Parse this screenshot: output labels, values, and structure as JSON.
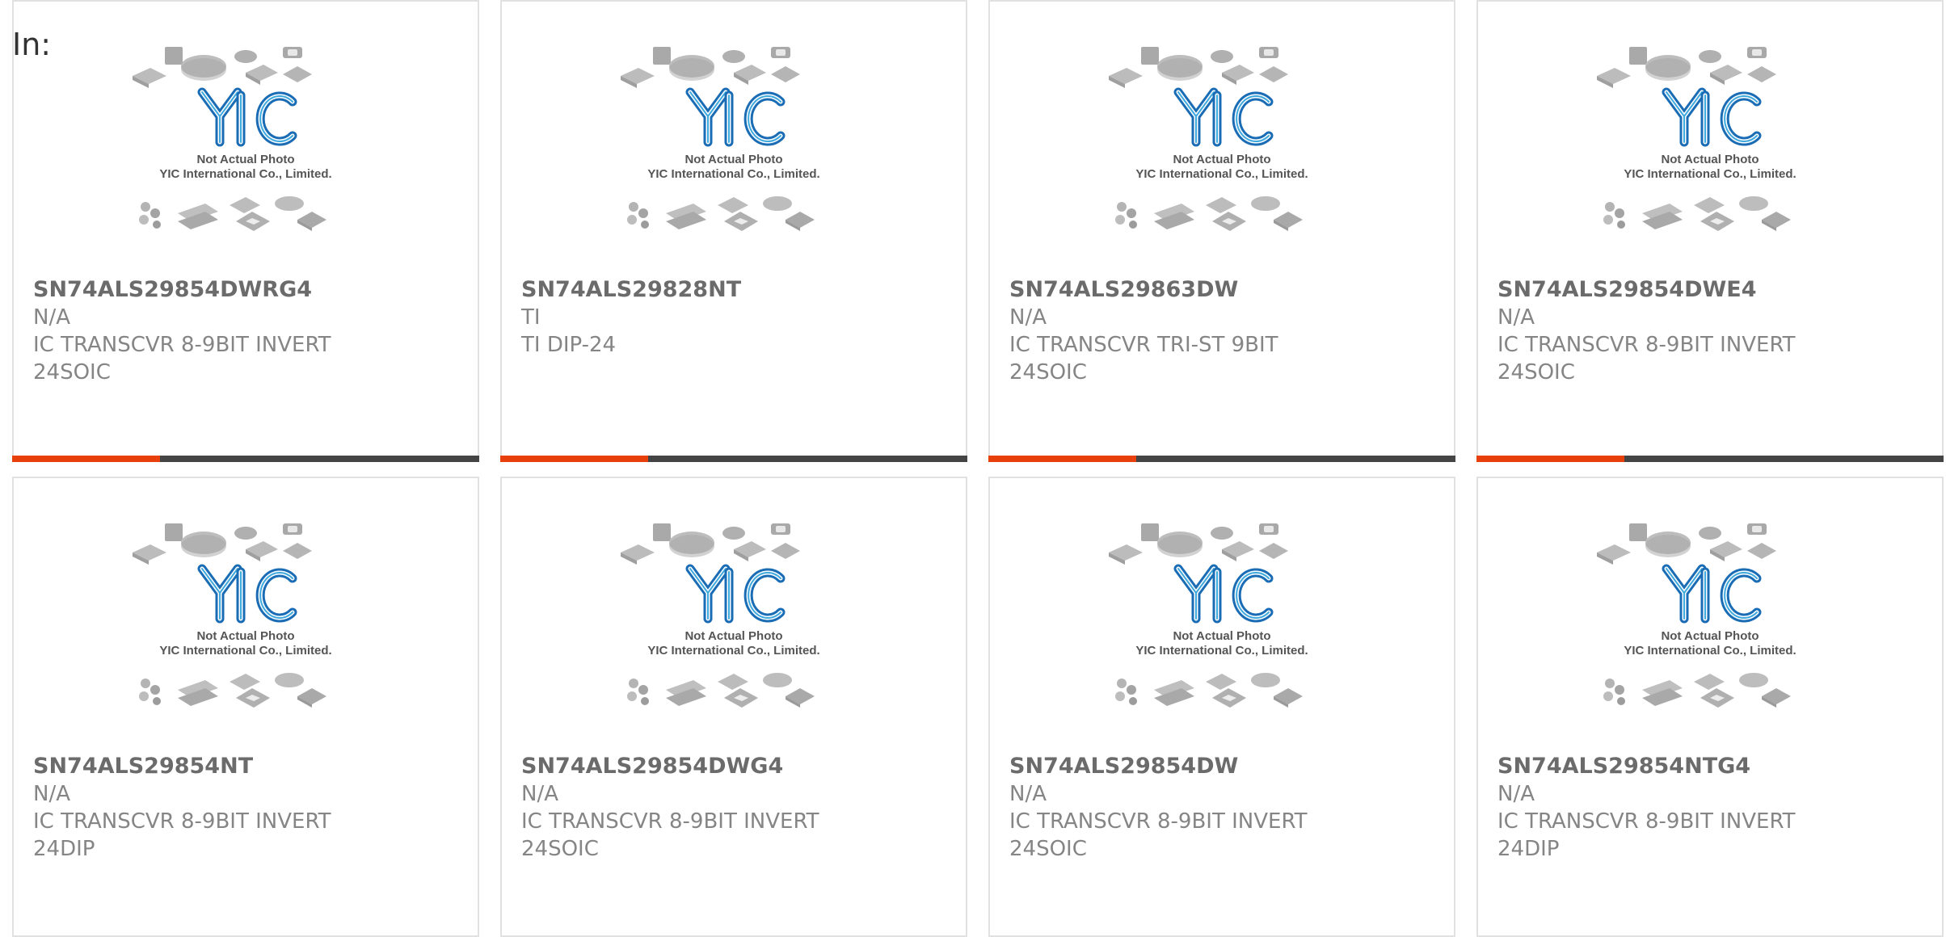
{
  "heading": "In:",
  "accent_color": "#e8400c",
  "bar_color": "#444444",
  "placeholder_image": {
    "icon": "chip-packages-placeholder-icon",
    "logo_text": "YIC",
    "caption_line1": "Not Actual Photo",
    "caption_line2": "YIC International Co., Limited."
  },
  "products": [
    {
      "part": "SN74ALS29854DWRG4",
      "manufacturer": "N/A",
      "desc1": "IC TRANSCVR 8-9BIT INVERT",
      "desc2": "24SOIC"
    },
    {
      "part": "SN74ALS29828NT",
      "manufacturer": "TI",
      "desc1": "TI DIP-24",
      "desc2": ""
    },
    {
      "part": "SN74ALS29863DW",
      "manufacturer": "N/A",
      "desc1": "IC TRANSCVR TRI-ST 9BIT",
      "desc2": "24SOIC"
    },
    {
      "part": "SN74ALS29854DWE4",
      "manufacturer": "N/A",
      "desc1": "IC TRANSCVR 8-9BIT INVERT",
      "desc2": "24SOIC"
    },
    {
      "part": "SN74ALS29854NT",
      "manufacturer": "N/A",
      "desc1": "IC TRANSCVR 8-9BIT INVERT",
      "desc2": "24DIP"
    },
    {
      "part": "SN74ALS29854DWG4",
      "manufacturer": "N/A",
      "desc1": "IC TRANSCVR 8-9BIT INVERT",
      "desc2": "24SOIC"
    },
    {
      "part": "SN74ALS29854DW",
      "manufacturer": "N/A",
      "desc1": "IC TRANSCVR 8-9BIT INVERT",
      "desc2": "24SOIC"
    },
    {
      "part": "SN74ALS29854NTG4",
      "manufacturer": "N/A",
      "desc1": "IC TRANSCVR 8-9BIT INVERT",
      "desc2": "24DIP"
    }
  ]
}
